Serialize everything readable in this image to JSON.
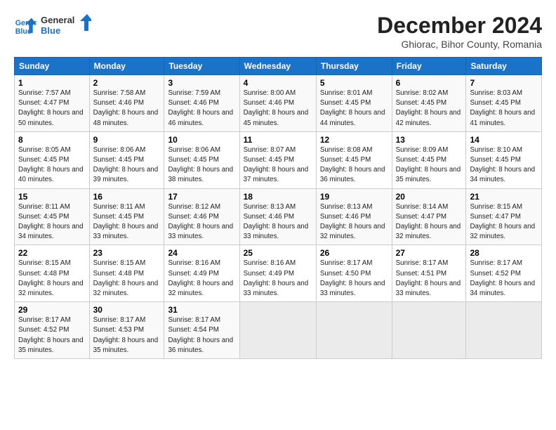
{
  "header": {
    "logo_line1": "General",
    "logo_line2": "Blue",
    "title": "December 2024",
    "subtitle": "Ghiorac, Bihor County, Romania"
  },
  "days_of_week": [
    "Sunday",
    "Monday",
    "Tuesday",
    "Wednesday",
    "Thursday",
    "Friday",
    "Saturday"
  ],
  "weeks": [
    [
      {
        "day": "1",
        "sunrise": "7:57 AM",
        "sunset": "4:47 PM",
        "daylight": "8 hours and 50 minutes."
      },
      {
        "day": "2",
        "sunrise": "7:58 AM",
        "sunset": "4:46 PM",
        "daylight": "8 hours and 48 minutes."
      },
      {
        "day": "3",
        "sunrise": "7:59 AM",
        "sunset": "4:46 PM",
        "daylight": "8 hours and 46 minutes."
      },
      {
        "day": "4",
        "sunrise": "8:00 AM",
        "sunset": "4:46 PM",
        "daylight": "8 hours and 45 minutes."
      },
      {
        "day": "5",
        "sunrise": "8:01 AM",
        "sunset": "4:45 PM",
        "daylight": "8 hours and 44 minutes."
      },
      {
        "day": "6",
        "sunrise": "8:02 AM",
        "sunset": "4:45 PM",
        "daylight": "8 hours and 42 minutes."
      },
      {
        "day": "7",
        "sunrise": "8:03 AM",
        "sunset": "4:45 PM",
        "daylight": "8 hours and 41 minutes."
      }
    ],
    [
      {
        "day": "8",
        "sunrise": "8:05 AM",
        "sunset": "4:45 PM",
        "daylight": "8 hours and 40 minutes."
      },
      {
        "day": "9",
        "sunrise": "8:06 AM",
        "sunset": "4:45 PM",
        "daylight": "8 hours and 39 minutes."
      },
      {
        "day": "10",
        "sunrise": "8:06 AM",
        "sunset": "4:45 PM",
        "daylight": "8 hours and 38 minutes."
      },
      {
        "day": "11",
        "sunrise": "8:07 AM",
        "sunset": "4:45 PM",
        "daylight": "8 hours and 37 minutes."
      },
      {
        "day": "12",
        "sunrise": "8:08 AM",
        "sunset": "4:45 PM",
        "daylight": "8 hours and 36 minutes."
      },
      {
        "day": "13",
        "sunrise": "8:09 AM",
        "sunset": "4:45 PM",
        "daylight": "8 hours and 35 minutes."
      },
      {
        "day": "14",
        "sunrise": "8:10 AM",
        "sunset": "4:45 PM",
        "daylight": "8 hours and 34 minutes."
      }
    ],
    [
      {
        "day": "15",
        "sunrise": "8:11 AM",
        "sunset": "4:45 PM",
        "daylight": "8 hours and 34 minutes."
      },
      {
        "day": "16",
        "sunrise": "8:11 AM",
        "sunset": "4:45 PM",
        "daylight": "8 hours and 33 minutes."
      },
      {
        "day": "17",
        "sunrise": "8:12 AM",
        "sunset": "4:46 PM",
        "daylight": "8 hours and 33 minutes."
      },
      {
        "day": "18",
        "sunrise": "8:13 AM",
        "sunset": "4:46 PM",
        "daylight": "8 hours and 33 minutes."
      },
      {
        "day": "19",
        "sunrise": "8:13 AM",
        "sunset": "4:46 PM",
        "daylight": "8 hours and 32 minutes."
      },
      {
        "day": "20",
        "sunrise": "8:14 AM",
        "sunset": "4:47 PM",
        "daylight": "8 hours and 32 minutes."
      },
      {
        "day": "21",
        "sunrise": "8:15 AM",
        "sunset": "4:47 PM",
        "daylight": "8 hours and 32 minutes."
      }
    ],
    [
      {
        "day": "22",
        "sunrise": "8:15 AM",
        "sunset": "4:48 PM",
        "daylight": "8 hours and 32 minutes."
      },
      {
        "day": "23",
        "sunrise": "8:15 AM",
        "sunset": "4:48 PM",
        "daylight": "8 hours and 32 minutes."
      },
      {
        "day": "24",
        "sunrise": "8:16 AM",
        "sunset": "4:49 PM",
        "daylight": "8 hours and 32 minutes."
      },
      {
        "day": "25",
        "sunrise": "8:16 AM",
        "sunset": "4:49 PM",
        "daylight": "8 hours and 33 minutes."
      },
      {
        "day": "26",
        "sunrise": "8:17 AM",
        "sunset": "4:50 PM",
        "daylight": "8 hours and 33 minutes."
      },
      {
        "day": "27",
        "sunrise": "8:17 AM",
        "sunset": "4:51 PM",
        "daylight": "8 hours and 33 minutes."
      },
      {
        "day": "28",
        "sunrise": "8:17 AM",
        "sunset": "4:52 PM",
        "daylight": "8 hours and 34 minutes."
      }
    ],
    [
      {
        "day": "29",
        "sunrise": "8:17 AM",
        "sunset": "4:52 PM",
        "daylight": "8 hours and 35 minutes."
      },
      {
        "day": "30",
        "sunrise": "8:17 AM",
        "sunset": "4:53 PM",
        "daylight": "8 hours and 35 minutes."
      },
      {
        "day": "31",
        "sunrise": "8:17 AM",
        "sunset": "4:54 PM",
        "daylight": "8 hours and 36 minutes."
      },
      {
        "day": "",
        "sunrise": "",
        "sunset": "",
        "daylight": ""
      },
      {
        "day": "",
        "sunrise": "",
        "sunset": "",
        "daylight": ""
      },
      {
        "day": "",
        "sunrise": "",
        "sunset": "",
        "daylight": ""
      },
      {
        "day": "",
        "sunrise": "",
        "sunset": "",
        "daylight": ""
      }
    ]
  ]
}
